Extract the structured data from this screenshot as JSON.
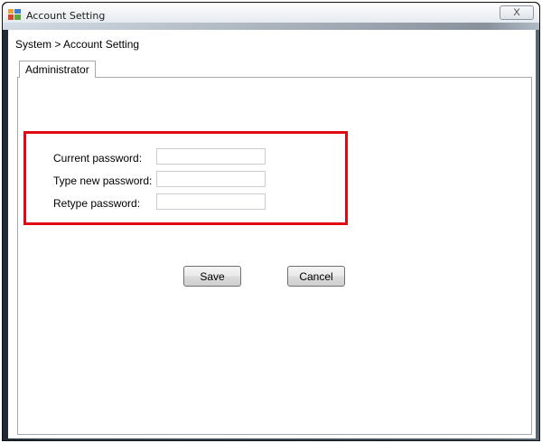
{
  "window": {
    "title": "Account Setting",
    "close_glyph": "X"
  },
  "breadcrumb": "System > Account Setting",
  "tabs": [
    {
      "label": "Administrator",
      "selected": true
    }
  ],
  "form": {
    "fields": [
      {
        "label": "Current password:",
        "value": ""
      },
      {
        "label": "Type new password:",
        "value": ""
      },
      {
        "label": "Retype password:",
        "value": ""
      }
    ],
    "save_label": "Save",
    "cancel_label": "Cancel"
  },
  "colors": {
    "highlight": "#e30613"
  }
}
